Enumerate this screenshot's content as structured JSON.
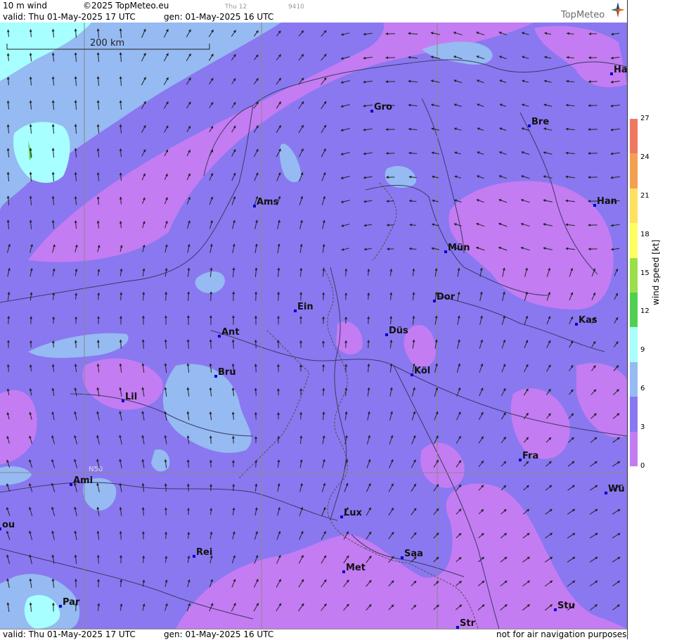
{
  "header": {
    "product": "10 m wind",
    "copyright": "©2025 TopMeteo.eu",
    "slot": "Thu 12",
    "code": "9410",
    "valid": "valid:  Thu   01-May-2025  17 UTC",
    "gen": "gen: 01-May-2025 16 UTC",
    "logo_text": "TopMeteo"
  },
  "footer": {
    "valid": "valid:  Thu   01-May-2025  17 UTC",
    "gen": "gen: 01-May-2025 16 UTC",
    "disclaimer": "not for air navigation purposes"
  },
  "scale_bar": {
    "label": "200 km"
  },
  "grid_label": "N50",
  "legend": {
    "title": "wind  speed  [kt]",
    "ticks": [
      "27",
      "24",
      "21",
      "18",
      "15",
      "12",
      "9",
      "6",
      "3",
      "0"
    ],
    "colors": [
      "#f07860",
      "#f5a050",
      "#ffe060",
      "#ffff60",
      "#9ae04a",
      "#50d050",
      "#a8ffff",
      "#96baf2",
      "#8a78f0",
      "#c47cf2"
    ]
  },
  "cities": [
    {
      "name": "Ha"
    },
    {
      "name": "Gro"
    },
    {
      "name": "Bre"
    },
    {
      "name": "Ams"
    },
    {
      "name": "Han"
    },
    {
      "name": "Mün"
    },
    {
      "name": "Ein"
    },
    {
      "name": "Dor"
    },
    {
      "name": "Kas"
    },
    {
      "name": "Ant"
    },
    {
      "name": "Düs"
    },
    {
      "name": "Bru"
    },
    {
      "name": "Köl"
    },
    {
      "name": "Lil"
    },
    {
      "name": "Fra"
    },
    {
      "name": "Ami"
    },
    {
      "name": "Wü"
    },
    {
      "name": "Lux"
    },
    {
      "name": "ou"
    },
    {
      "name": "Rei"
    },
    {
      "name": "Saa"
    },
    {
      "name": "Met"
    },
    {
      "name": "Par"
    },
    {
      "name": "Stu"
    },
    {
      "name": "Str"
    }
  ]
}
